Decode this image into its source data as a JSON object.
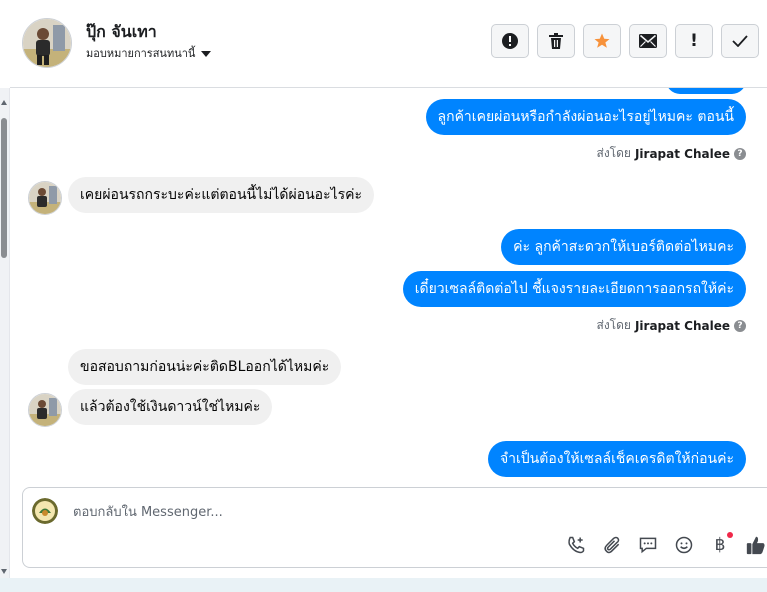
{
  "header": {
    "contact_name": "ปุ๊ก จันเทา",
    "assign_label": "มอบหมายการสนทนานี้"
  },
  "actions": [
    {
      "icon": "alert-circle-icon",
      "name": "spam-button"
    },
    {
      "icon": "trash-icon",
      "name": "delete-button"
    },
    {
      "icon": "star-icon",
      "name": "follow-up-button",
      "color": "#f7923b"
    },
    {
      "icon": "mail-icon",
      "name": "mark-unread-button"
    },
    {
      "icon": "exclamation-icon",
      "name": "important-button",
      "label": "!"
    },
    {
      "icon": "checkmark-icon",
      "name": "done-button"
    }
  ],
  "messages": {
    "m1": "ลูกค้าเคยผ่อนหรือกำลังผ่อนอะไรอยู่ไหมคะ ตอนนี้",
    "m2": "เคยผ่อนรถกระบะค่ะแต่ตอนนี้ไม่ได้ผ่อนอะไรค่ะ",
    "m3": "ค่ะ ลูกค้าสะดวกให้เบอร์ติดต่อไหมคะ",
    "m4": "เดี๋ยวเซลล์ติดต่อไป ชี้แจงรายละเอียดการออกรถให้ค่ะ",
    "m5": "ขอสอบถามก่อนน่ะค่ะติดBLออกได้ไหมค่ะ",
    "m6": "แล้วต้องใช้เงินดาวน์ใช่ไหมค่ะ",
    "m7": "จำเป็นต้องให้เซลล์เช็คเครดิตให้ก่อนค่ะ"
  },
  "sent_by": {
    "prefix": "ส่งโดย",
    "agent": "Jirapat Chalee"
  },
  "composer": {
    "placeholder": "ตอบกลับใน Messenger..."
  },
  "tools": [
    "phone-add-icon",
    "paperclip-icon",
    "saved-reply-icon",
    "emoji-icon",
    "baht-icon",
    "thumbs-up-icon"
  ],
  "colors": {
    "outgoing_bubble": "#0084ff",
    "incoming_bubble": "#f0f0f0",
    "star": "#f7923b"
  },
  "baht_symbol": "฿"
}
